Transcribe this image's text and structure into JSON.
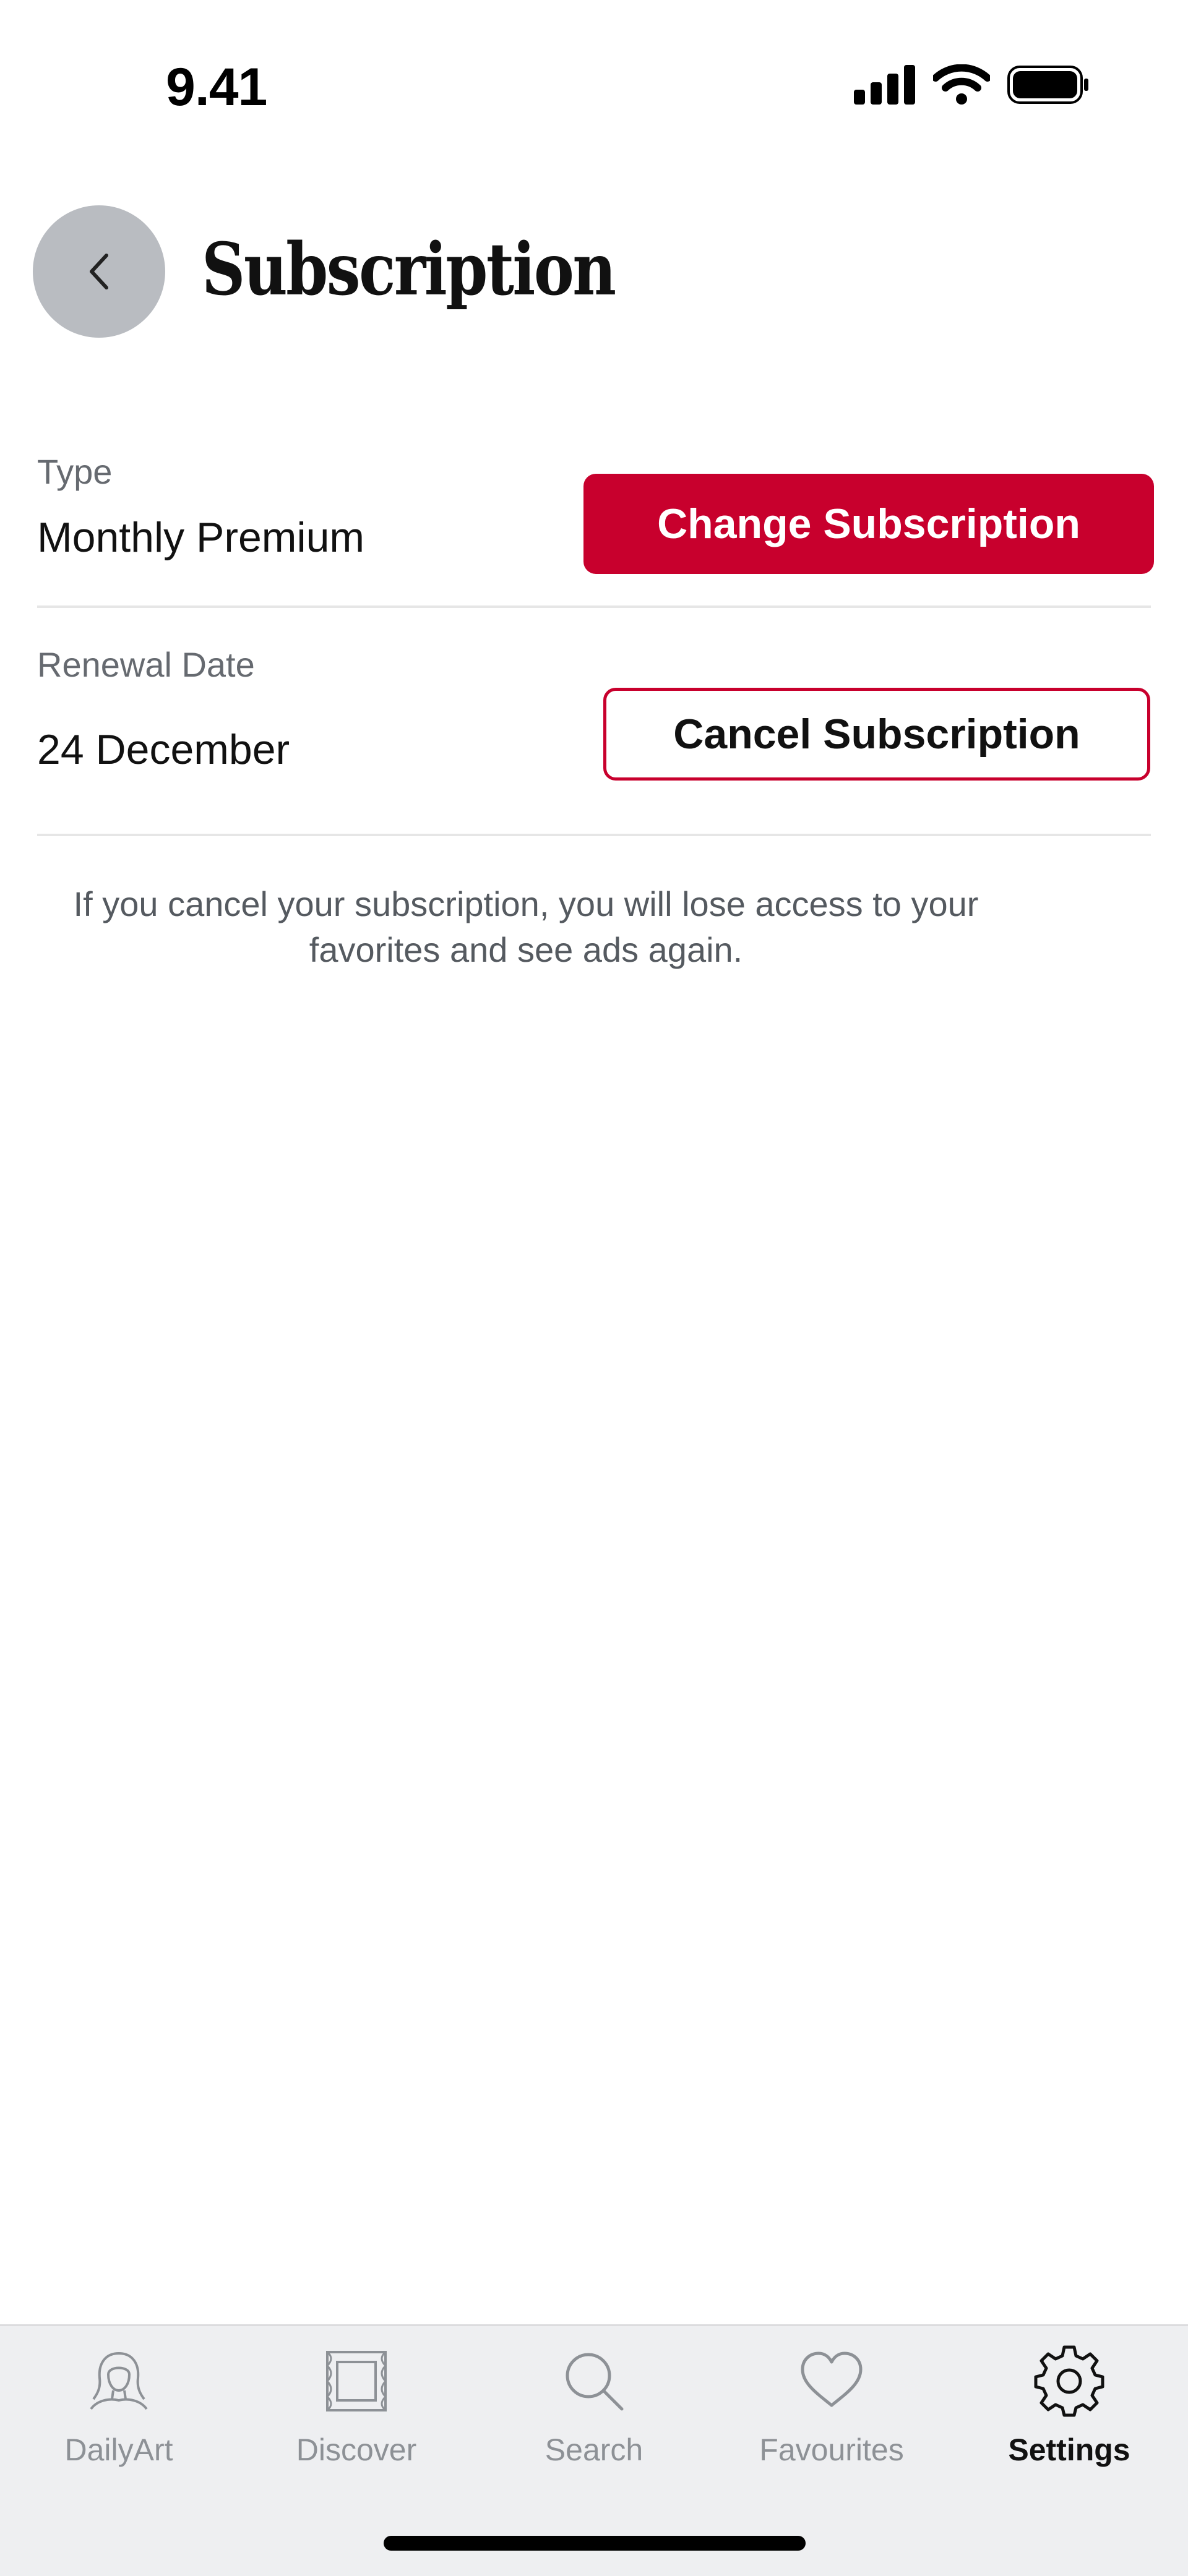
{
  "status_bar": {
    "time": "9.41"
  },
  "header": {
    "title": "Subscription",
    "back_icon": "chevron-left-icon"
  },
  "subscription": {
    "type_label": "Type",
    "type_value": "Monthly Premium",
    "change_button": "Change Subscription",
    "renewal_label": "Renewal Date",
    "renewal_value": "24 December",
    "cancel_button": "Cancel Subscription",
    "note": "If you cancel your subscription, you will lose access to your favorites and see ads again."
  },
  "tab_bar": {
    "tabs": [
      {
        "label": "DailyArt",
        "icon": "portrait-icon",
        "active": false
      },
      {
        "label": "Discover",
        "icon": "frame-icon",
        "active": false
      },
      {
        "label": "Search",
        "icon": "search-icon",
        "active": false
      },
      {
        "label": "Favourites",
        "icon": "heart-icon",
        "active": false
      },
      {
        "label": "Settings",
        "icon": "gear-icon",
        "active": true
      }
    ]
  },
  "colors": {
    "accent": "#c8002d",
    "back_button_bg": "#b9bcc1",
    "tabbar_bg": "#eeeff1",
    "inactive_tab": "#8d9196"
  }
}
